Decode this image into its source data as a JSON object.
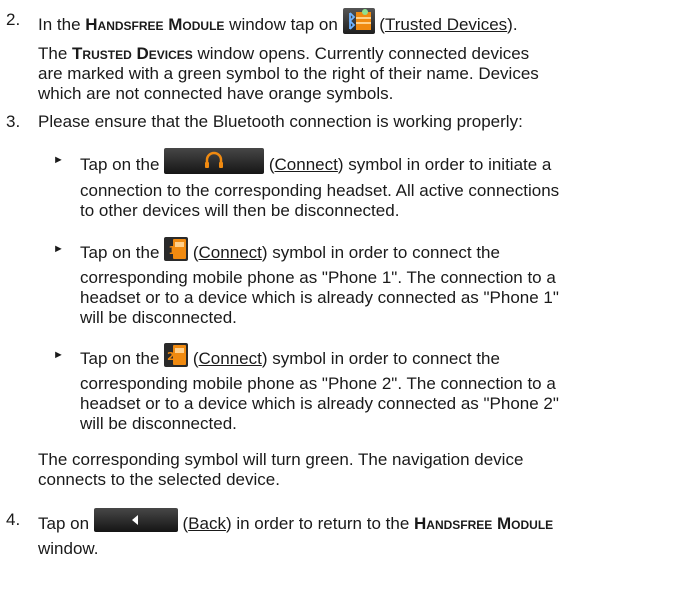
{
  "step2": {
    "number": "2.",
    "pre": "In the ",
    "bold": "Handsfree Module",
    "mid": " window tap on ",
    "icon": "trusted-devices-icon",
    "link": "Trusted Devices",
    "post": ").",
    "open_paren": " (",
    "p2_bold": "Trusted Devices",
    "p2_line1": " window opens. Currently connected devices",
    "p2_prefix": "The ",
    "p2_line2": "are marked with a green symbol to the right of their name. Devices",
    "p2_line3": "which are not connected have orange symbols."
  },
  "step3": {
    "number": "3.",
    "text": "Please ensure that the Bluetooth connection is working properly:",
    "bullets": [
      {
        "arrow": "►",
        "pre": "Tap on the ",
        "icon": "headset-connect-icon",
        "link": "Connect",
        "line1_post": ") symbol in order to initiate a",
        "line2": "connection to the corresponding headset. All active connections",
        "line3": "to other devices will then be disconnected."
      },
      {
        "arrow": "►",
        "pre": "Tap on the ",
        "icon": "phone1-connect-icon",
        "link": "Connect",
        "line1_post": ") symbol in order to connect the",
        "line2": "corresponding mobile phone as \"Phone 1\". The connection to a",
        "line3": "headset or to a device which is already connected as \"Phone 1\"",
        "line4": "will be disconnected."
      },
      {
        "arrow": "►",
        "pre": "Tap on the ",
        "icon": "phone2-connect-icon",
        "link": "Connect",
        "line1_post": ") symbol in order to connect the",
        "line2": "corresponding mobile phone as \"Phone 2\". The connection to a",
        "line3": "headset or to a device which is already connected as \"Phone 2\"",
        "line4": "will be disconnected."
      }
    ],
    "result_line1": "The corresponding symbol will turn green. The navigation device",
    "result_line2": "connects to the selected device."
  },
  "step4": {
    "number": "4.",
    "pre": "Tap on ",
    "icon": "back-arrow-icon",
    "link": "Back",
    "mid": ") in order to return to the ",
    "bold": "Handsfree Module",
    "line2": "window."
  },
  "colors": {
    "orange": "#f08a10",
    "green_check": "#4caf50",
    "dark_button": "#2a2a2a",
    "icon_blue": "#2f6fb0"
  }
}
